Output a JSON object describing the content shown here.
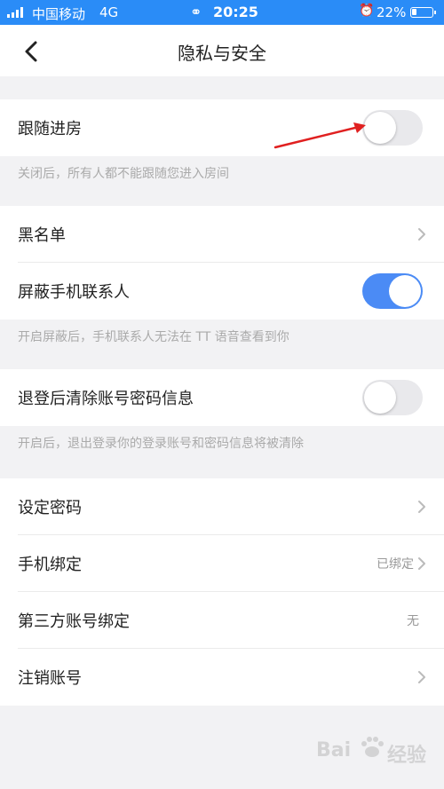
{
  "status_bar": {
    "carrier": "中国移动",
    "network": "4G",
    "time": "20:25",
    "battery": "22%",
    "battery_level": 0.22
  },
  "nav": {
    "title": "隐私与安全"
  },
  "sections": {
    "follow": {
      "label": "跟随进房",
      "toggle_on": false,
      "hint": "关闭后，所有人都不能跟随您进入房间"
    },
    "blacklist": {
      "label": "黑名单"
    },
    "block_contacts": {
      "label": "屏蔽手机联系人",
      "toggle_on": true,
      "hint": "开启屏蔽后，手机联系人无法在 TT 语音查看到你"
    },
    "clear_account": {
      "label": "退登后清除账号密码信息",
      "toggle_on": false,
      "hint": "开启后，退出登录你的登录账号和密码信息将被清除"
    },
    "set_password": {
      "label": "设定密码"
    },
    "phone_binding": {
      "label": "手机绑定",
      "value": "已绑定"
    },
    "third_party": {
      "label": "第三方账号绑定",
      "value": "无"
    },
    "cancel_account": {
      "label": "注销账号"
    }
  },
  "watermark": {
    "left": "Bai",
    "right": "经验"
  },
  "colors": {
    "status_bar": "#2a8cf7",
    "toggle_on": "#4b8bf5",
    "toggle_off": "#e9e9ec",
    "annotation_arrow": "#e02020",
    "background": "#f2f2f4"
  },
  "icons": {
    "back": "chevron-left-icon",
    "row_more": "chevron-right-icon",
    "alarm": "alarm-icon",
    "link": "link-icon",
    "signal": "signal-icon",
    "battery": "battery-icon"
  }
}
